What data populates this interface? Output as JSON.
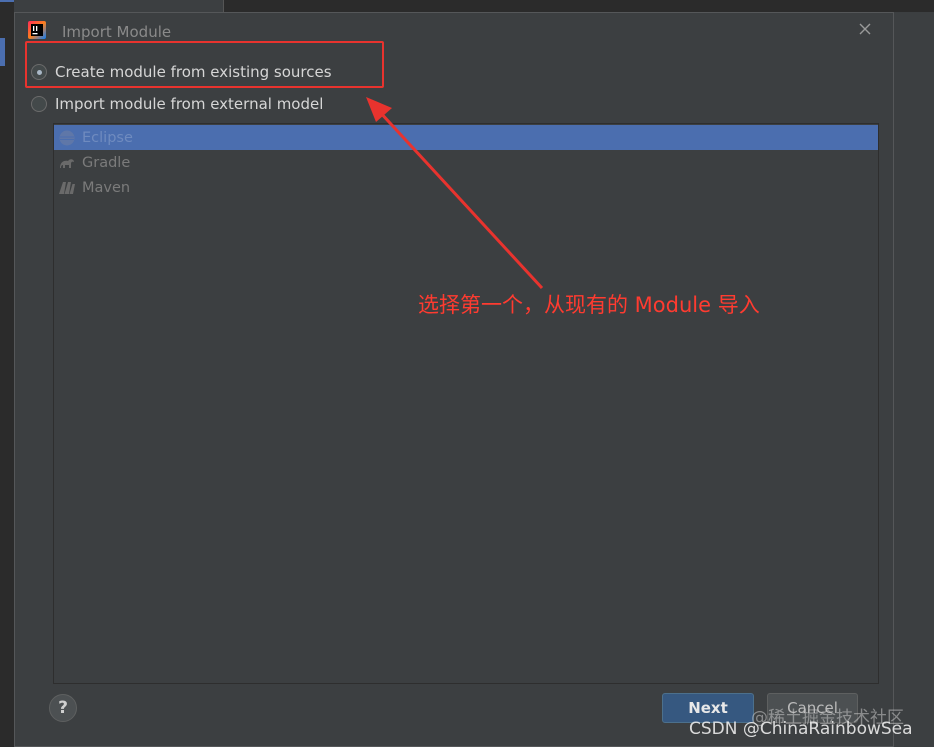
{
  "dialog": {
    "title": "Import Module",
    "close_icon": "close-icon"
  },
  "options": {
    "create_label": "Create module from existing sources",
    "import_label": "Import module from external model",
    "selected": "create"
  },
  "models": [
    {
      "label": "Eclipse",
      "icon": "eclipse-icon",
      "selected": true
    },
    {
      "label": "Gradle",
      "icon": "gradle-icon",
      "selected": false
    },
    {
      "label": "Maven",
      "icon": "maven-icon",
      "selected": false
    }
  ],
  "buttons": {
    "help": "?",
    "next": "Next",
    "cancel": "Cancel"
  },
  "annotation": {
    "text": "选择第一个，从现有的 Module 导入",
    "color": "#ff3b30"
  },
  "watermark": {
    "line1": "@稀土掘金技术社区",
    "line2": "CSDN @ChinaRainbowSea"
  },
  "colors": {
    "selection": "#4b6eaf",
    "dialog_bg": "#3c3f41",
    "next_button": "#365880"
  }
}
